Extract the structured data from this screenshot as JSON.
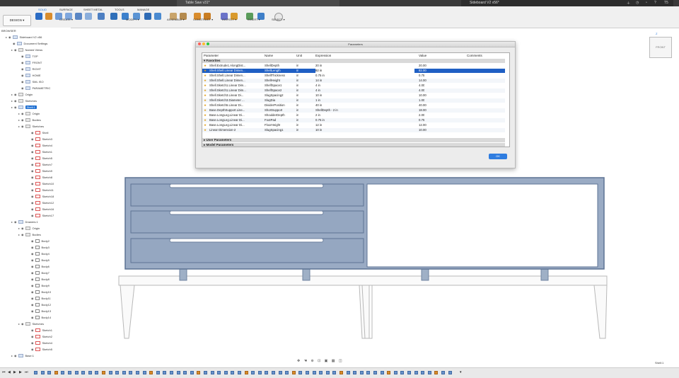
{
  "window": {
    "left_tab": "Table Saw v31*",
    "right_tab": "Sideboard V2 v56*",
    "tab_count": "T5"
  },
  "toolbar": {
    "design_button": "DESIGN ▾",
    "tabs": [
      "SOLID",
      "SURFACE",
      "SHEET METAL",
      "TOOLS",
      "MANAGE"
    ],
    "groups": [
      "CREATE ▾",
      "MODIFY ▾",
      "ASSEMBLE ▾",
      "CONSTRUCT ▾",
      "INSPECT ▾",
      "INSERT ▾",
      "SELECT ▾"
    ]
  },
  "browser": {
    "header": "BROWSER",
    "items": [
      {
        "label": "Sideboard V2 v56"
      },
      {
        "label": "Document Settings"
      },
      {
        "label": "Named Views"
      },
      {
        "label": "TOP"
      },
      {
        "label": "FRONT"
      },
      {
        "label": "RIGHT"
      },
      {
        "label": "HOME"
      },
      {
        "label": "SML ISO"
      },
      {
        "label": "PARAMETRIC"
      },
      {
        "label": "Origin"
      },
      {
        "label": "Sketches"
      },
      {
        "label": "Shell:1"
      },
      {
        "label": "Origin"
      },
      {
        "label": "Bodies"
      },
      {
        "label": "Sketches"
      },
      {
        "label": "Shell"
      },
      {
        "label": "Sketch3"
      },
      {
        "label": "Sketch4"
      },
      {
        "label": "Sketch1"
      },
      {
        "label": "Sketch5"
      },
      {
        "label": "Sketch7"
      },
      {
        "label": "Sketch9"
      },
      {
        "label": "Sketch8"
      },
      {
        "label": "Sketch10"
      },
      {
        "label": "Sketch11"
      },
      {
        "label": "Sketch18"
      },
      {
        "label": "Sketch12"
      },
      {
        "label": "Sketch16"
      },
      {
        "label": "Sketch17"
      },
      {
        "label": "Drawers:1"
      },
      {
        "label": "Origin"
      },
      {
        "label": "Bodies"
      },
      {
        "label": "Body2"
      },
      {
        "label": "Body3"
      },
      {
        "label": "Body4"
      },
      {
        "label": "Body5"
      },
      {
        "label": "Body6"
      },
      {
        "label": "Body7"
      },
      {
        "label": "Body8"
      },
      {
        "label": "Body9"
      },
      {
        "label": "Body10"
      },
      {
        "label": "Body11"
      },
      {
        "label": "Body12"
      },
      {
        "label": "Body13"
      },
      {
        "label": "Body14"
      },
      {
        "label": "Sketches"
      },
      {
        "label": "Sketch1"
      },
      {
        "label": "Sketch2"
      },
      {
        "label": "Sketch4"
      },
      {
        "label": "Sketch5"
      },
      {
        "label": "Base:1"
      }
    ]
  },
  "viewcube": {
    "label": "FRONT",
    "axis": "Z"
  },
  "dialog": {
    "title": "Parameters",
    "columns": [
      "Parameter",
      "Name",
      "Unit",
      "Expression",
      "Value",
      "Comments"
    ],
    "favorites_label": "Favorites",
    "rows": [
      {
        "param": "Shell.Extrude1.AlongDist...",
        "name": "ShellDepth",
        "unit": "in",
        "expr": "20 in",
        "value": "20.00"
      },
      {
        "param": "Shell.Shell.Linear Dimen...",
        "name": "ShellLength",
        "unit": "in",
        "expr": "82 in",
        "value": "82.00"
      },
      {
        "param": "Shell.Shell.Linear Dimen...",
        "name": "ShellThickness",
        "unit": "in",
        "expr": "0.75 in",
        "value": "0.75"
      },
      {
        "param": "Shell.Shell.Linear Dimen...",
        "name": "ShellHeight",
        "unit": "in",
        "expr": "14 in",
        "value": "14.00"
      },
      {
        "param": "Shell.Sketch1.Linear Dim...",
        "name": "ShelfSpace1",
        "unit": "in",
        "expr": "4 in",
        "value": "4.00"
      },
      {
        "param": "Shell.Sketch1.Linear Dim...",
        "name": "ShelfSpace2",
        "unit": "in",
        "expr": "4 in",
        "value": "4.00"
      },
      {
        "param": "Shell.Sketch3.Linear Di...",
        "name": "SlugSpacing2",
        "unit": "in",
        "expr": "10 in",
        "value": "10.00"
      },
      {
        "param": "Shell.Sketch3.Diameter ...",
        "name": "SlugDia",
        "unit": "in",
        "expr": "1 in",
        "value": "1.00"
      },
      {
        "param": "Shell.Sketch5.Linear Di...",
        "name": "DividerPosition",
        "unit": "in",
        "expr": "40 in",
        "value": "40.00"
      },
      {
        "param": "Base.DepthSupport.Line...",
        "name": "ShortSupport",
        "unit": "in",
        "expr": "ShellDepth - 2 in",
        "value": "18.00"
      },
      {
        "param": "Base.LongLeg.Linear Di...",
        "name": "ShoulderDepth",
        "unit": "in",
        "expr": "2 in",
        "value": "2.00"
      },
      {
        "param": "Base.LongLeg.Linear Di...",
        "name": "FootPad",
        "unit": "in",
        "expr": "0.75 in",
        "value": "0.75"
      },
      {
        "param": "Base.LongLeg.Linear Di...",
        "name": "FloorHeight",
        "unit": "in",
        "expr": "12 in",
        "value": "12.00"
      },
      {
        "param": "Linear Dimension-2",
        "name": "SlugSpacing1",
        "unit": "in",
        "expr": "10 in",
        "value": "10.00"
      }
    ],
    "user_params_label": "User Parameters",
    "model_params_label": "Model Parameters",
    "ok_label": "OK"
  },
  "status": {
    "component": "Shell:1"
  }
}
